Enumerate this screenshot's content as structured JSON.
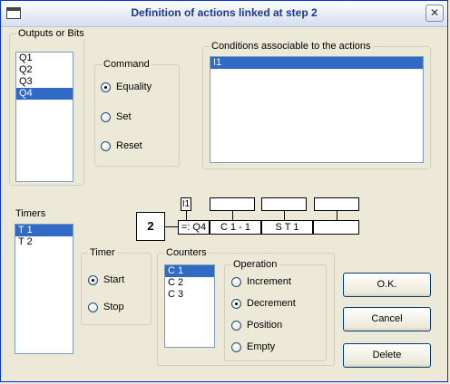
{
  "window": {
    "title": "Definition of actions linked at step 2",
    "close_glyph": "✕"
  },
  "outputs": {
    "label": "Outputs or Bits",
    "items": [
      "Q1",
      "Q2",
      "Q3",
      "Q4"
    ],
    "selected": "Q4"
  },
  "command": {
    "legend": "Command",
    "options": [
      "Equality",
      "Set",
      "Reset"
    ],
    "selected": "Equality"
  },
  "conditions": {
    "legend": "Conditions associable to the actions",
    "items": [
      "I1"
    ],
    "selected": "I1"
  },
  "timers": {
    "label": "Timers",
    "items": [
      "T 1",
      "T 2"
    ],
    "selected": "T 1"
  },
  "timer": {
    "legend": "Timer",
    "options": [
      "Start",
      "Stop"
    ],
    "selected": "Start"
  },
  "counters": {
    "legend": "Counters",
    "items": [
      "C 1",
      "C 2",
      "C 3"
    ],
    "selected": "C 1"
  },
  "operation": {
    "legend": "Operation",
    "options": [
      "Increment",
      "Decrement",
      "Position",
      "Empty"
    ],
    "selected": "Decrement"
  },
  "grafcet": {
    "step_number": "2",
    "condition_tag": "I1",
    "cell_1": "=: Q4",
    "cell_2": "C 1 - 1",
    "cell_3": "S T 1",
    "cell_4": "",
    "top_1": "",
    "top_2": "",
    "top_3": ""
  },
  "buttons": {
    "ok": "O.K.",
    "cancel": "Cancel",
    "delete": "Delete"
  }
}
